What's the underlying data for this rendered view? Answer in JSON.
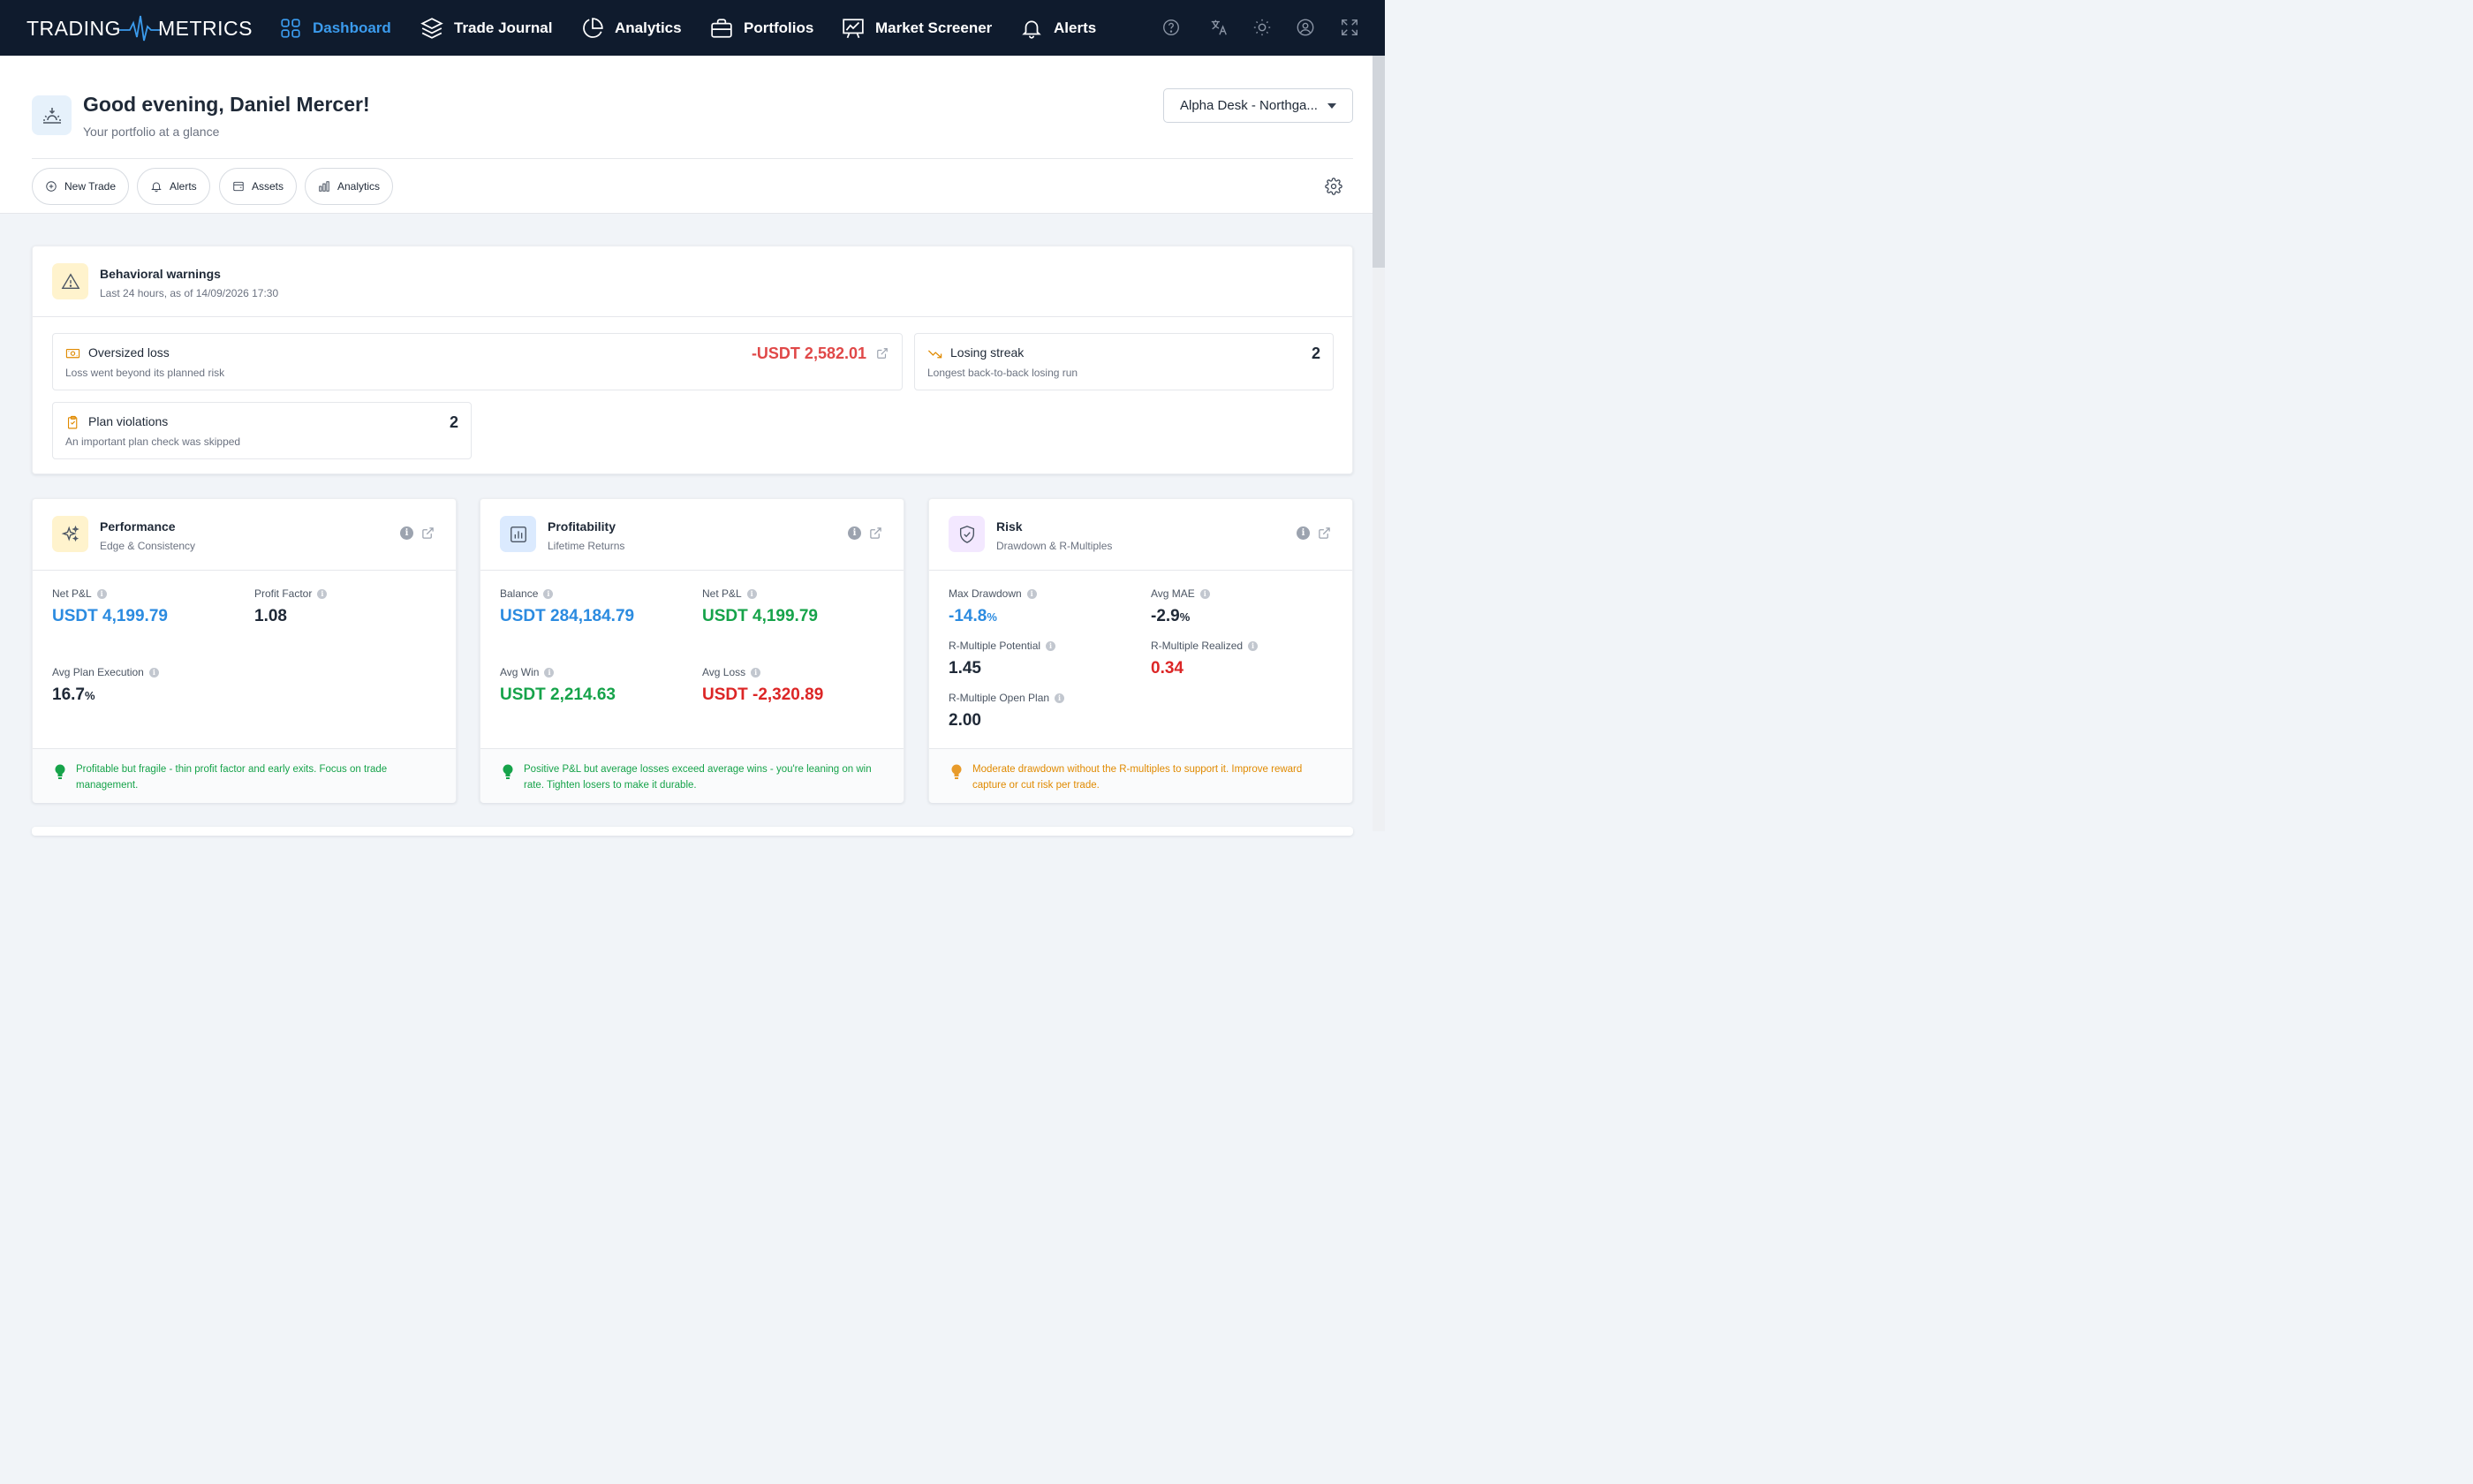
{
  "nav": {
    "logo_left": "TRADING",
    "logo_right": "METRICS",
    "items": [
      {
        "label": "Dashboard",
        "icon": "grid-icon",
        "active": true
      },
      {
        "label": "Trade Journal",
        "icon": "layers-icon"
      },
      {
        "label": "Analytics",
        "icon": "pie-chart-icon"
      },
      {
        "label": "Portfolios",
        "icon": "briefcase-icon"
      },
      {
        "label": "Market Screener",
        "icon": "presentation-chart-icon"
      },
      {
        "label": "Alerts",
        "icon": "bell-icon"
      }
    ],
    "right_icons": [
      "help-icon",
      "translate-icon",
      "sun-icon",
      "user-icon",
      "fullscreen-icon"
    ]
  },
  "header": {
    "greeting": "Good evening, Daniel Mercer!",
    "subtitle": "Your portfolio at a glance",
    "account": "Alpha Desk - Northga...",
    "actions": [
      {
        "label": "New Trade",
        "icon": "plus-circle-icon"
      },
      {
        "label": "Alerts",
        "icon": "bell-icon"
      },
      {
        "label": "Assets",
        "icon": "wallet-icon"
      },
      {
        "label": "Analytics",
        "icon": "bar-chart-icon"
      }
    ]
  },
  "warnings": {
    "title": "Behavioral warnings",
    "subtitle": "Last 24 hours, as of 14/09/2026 17:30",
    "items": [
      {
        "title": "Oversized loss",
        "desc": "Loss went beyond its planned risk",
        "value": "-USDT 2,582.01"
      },
      {
        "title": "Losing streak",
        "desc": "Longest back-to-back losing run",
        "value": "2"
      },
      {
        "title": "Plan violations",
        "desc": "An important plan check was skipped",
        "value": "2"
      }
    ]
  },
  "performance": {
    "title": "Performance",
    "subtitle": "Edge & Consistency",
    "metrics": [
      {
        "label": "Net P&L",
        "value": "USDT 4,199.79"
      },
      {
        "label": "Profit Factor",
        "value": "1.08"
      },
      {
        "label": "Avg Plan Execution",
        "value": "16.7",
        "unit": "%"
      }
    ],
    "footer": "Profitable but fragile - thin profit factor and early exits. Focus on trade management."
  },
  "profitability": {
    "title": "Profitability",
    "subtitle": "Lifetime Returns",
    "metrics": [
      {
        "label": "Balance",
        "value": "USDT 284,184.79"
      },
      {
        "label": "Net P&L",
        "value": "USDT 4,199.79"
      },
      {
        "label": "Avg Win",
        "value": "USDT 2,214.63"
      },
      {
        "label": "Avg Loss",
        "value": "USDT -2,320.89"
      }
    ],
    "footer": "Positive P&L but average losses exceed average wins - you're leaning on win rate. Tighten losers to make it durable."
  },
  "risk": {
    "title": "Risk",
    "subtitle": "Drawdown & R-Multiples",
    "metrics": [
      {
        "label": "Max Drawdown",
        "value": "-14.8",
        "unit": "%"
      },
      {
        "label": "Avg MAE",
        "value": "-2.9",
        "unit": "%"
      },
      {
        "label": "R-Multiple Potential",
        "value": "1.45"
      },
      {
        "label": "R-Multiple Realized",
        "value": "0.34"
      },
      {
        "label": "R-Multiple Open Plan",
        "value": "2.00"
      }
    ],
    "footer": "Moderate drawdown without the R-multiples to support it. Improve reward capture or cut risk per trade."
  },
  "colors": {
    "nav_bg": "#0f1b2d",
    "accent": "#3b9bed",
    "positive": "#16a34a",
    "negative": "#dc2626",
    "warning": "#e08a00"
  }
}
